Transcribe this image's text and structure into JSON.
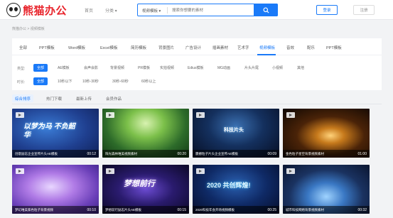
{
  "header": {
    "logo_text": "熊猫办公",
    "nav_home": "首页",
    "nav_category": "分类 ▾",
    "search_type": "视频模板 ▾",
    "search_placeholder": "搜索你想要的素材",
    "login_label": "登录",
    "register_label": "注册"
  },
  "breadcrumb": "熊猫办公 > 视频模板",
  "tabs": [
    {
      "label": "全部"
    },
    {
      "label": "PPT模板"
    },
    {
      "label": "Word模板"
    },
    {
      "label": "Excel模板"
    },
    {
      "label": "简历模板"
    },
    {
      "label": "背景图片"
    },
    {
      "label": "广告设计"
    },
    {
      "label": "插画素材"
    },
    {
      "label": "艺术字"
    },
    {
      "label": "视频模板"
    },
    {
      "label": "音效"
    },
    {
      "label": "配乐"
    },
    {
      "label": "PPT模板"
    }
  ],
  "filters": {
    "type_label": "类型:",
    "type_options": [
      "全部",
      "AE模板",
      "会声会影",
      "背景视频",
      "PR模板",
      "实拍视频",
      "Edius模板",
      "MG动画",
      "片头片尾",
      "小视频",
      "其他"
    ],
    "duration_label": "时长:",
    "duration_options": [
      "全部",
      "10秒以下",
      "10秒-30秒",
      "30秒-60秒",
      "60秒以上"
    ]
  },
  "sort": [
    "综合排序",
    "热门下载",
    "最新上传",
    "会员作品"
  ],
  "cards": [
    {
      "title": "创意励志企业宣传片头AE模板",
      "duration": "00:12",
      "overlay": "以梦为马 不负韶华"
    },
    {
      "title": "阳光森林唯美视频素材",
      "duration": "00:20",
      "overlay": ""
    },
    {
      "title": "震撼粒子片头企业宣传AE模板",
      "duration": "00:09",
      "overlay": "科技片头"
    },
    {
      "title": "金色粒子星空背景视频素材",
      "duration": "01:00",
      "overlay": ""
    },
    {
      "title": "梦幻唯美紫色粒子背景视频",
      "duration": "00:10",
      "overlay": ""
    },
    {
      "title": "梦想前行励志片头AE模板",
      "duration": "00:15",
      "overlay": "梦想前行"
    },
    {
      "title": "2020科技年会开场视频模板",
      "duration": "00:25",
      "overlay": "2020 共创辉煌!"
    },
    {
      "title": "城市科技网络背景视频素材",
      "duration": "00:32",
      "overlay": ""
    }
  ],
  "colors": {
    "accent": "#1a7af8",
    "brand": "#e8232b"
  }
}
